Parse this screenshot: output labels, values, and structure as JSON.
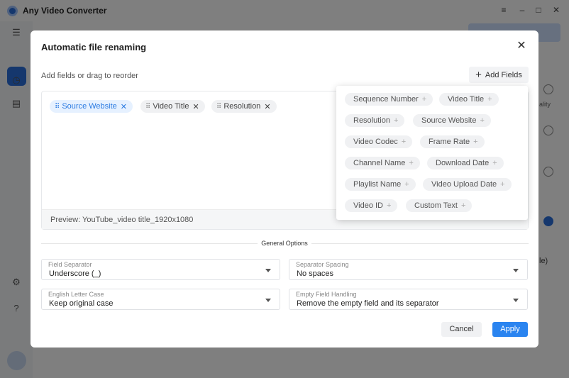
{
  "app": {
    "title": "Any Video Converter",
    "window_controls": [
      "≡",
      "–",
      "□",
      "✕"
    ],
    "bg_partial_text": [
      "ality",
      "le)"
    ]
  },
  "dialog": {
    "title": "Automatic file renaming",
    "close_icon": "close-icon",
    "hint": "Add fields or drag to reorder",
    "add_fields_label": "Add Fields",
    "selected_fields": [
      {
        "label": "Source Website",
        "active": true
      },
      {
        "label": "Video Title",
        "active": false
      },
      {
        "label": "Resolution",
        "active": false
      }
    ],
    "preview": "Preview: YouTube_video title_1920x1080",
    "general_options_label": "General Options",
    "options": {
      "field_separator": {
        "label": "Field Separator",
        "value": "Underscore (_)"
      },
      "separator_spacing": {
        "label": "Separator Spacing",
        "value": "No spaces"
      },
      "letter_case": {
        "label": "English Letter Case",
        "value": "Keep original case"
      },
      "empty_field": {
        "label": "Empty Field Handling",
        "value": "Remove the empty field and its separator"
      }
    },
    "cancel_label": "Cancel",
    "apply_label": "Apply"
  },
  "add_fields_menu": [
    "Sequence Number",
    "Video Title",
    "Resolution",
    "Source Website",
    "Video Codec",
    "Frame Rate",
    "Channel Name",
    "Download Date",
    "Playlist Name",
    "Video Upload Date",
    "Video ID",
    "Custom Text"
  ],
  "colors": {
    "accent": "#2a84f0",
    "active_chip_bg": "#e6f1ff",
    "active_chip_text": "#2a7ae2"
  }
}
